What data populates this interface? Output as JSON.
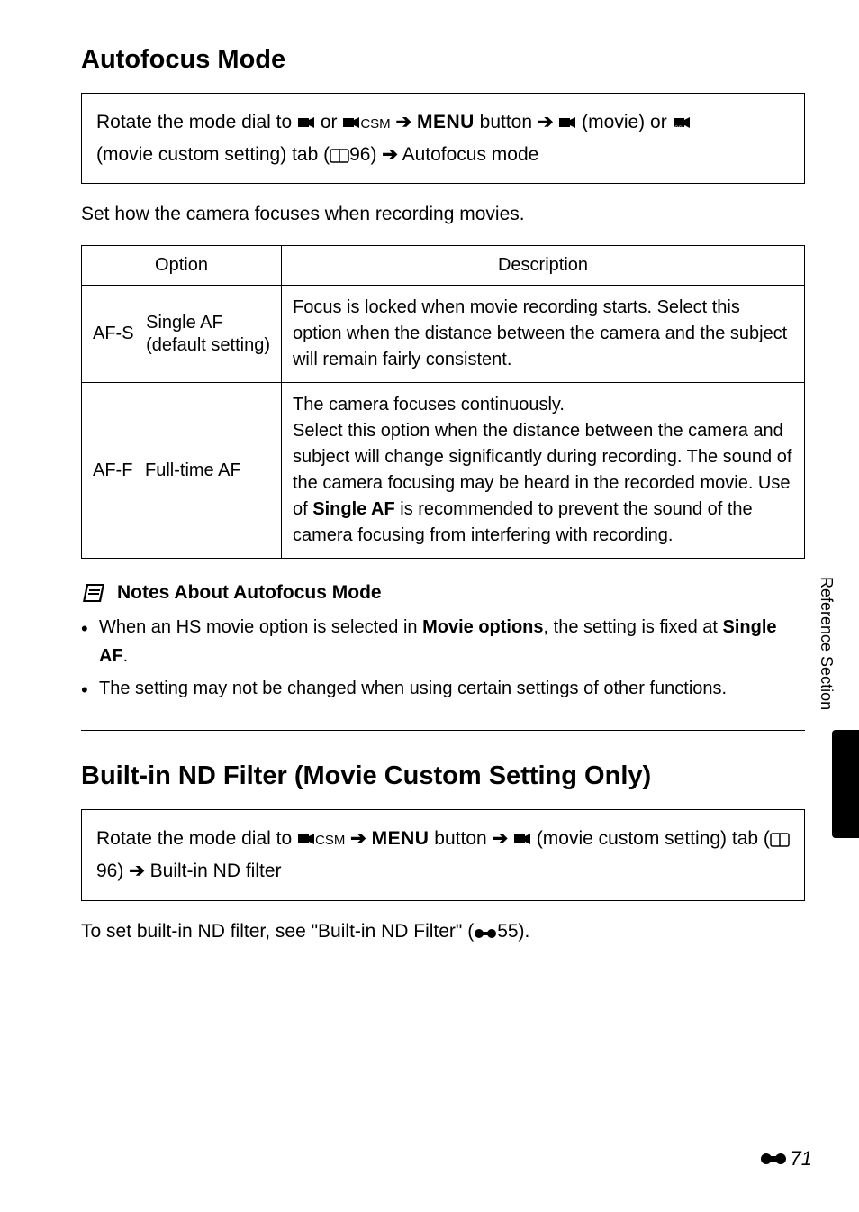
{
  "section1": {
    "title": "Autofocus Mode",
    "nav": {
      "prefix": "Rotate the mode dial to ",
      "or": " or ",
      "csm_after_movie": "CSM",
      "menu_button": " button ",
      "movie_or": " (movie) or ",
      "custom_tab": "(movie custom setting) tab (",
      "page_ref": "96) ",
      "tail": " Autofocus mode",
      "menu_label": "MENU"
    },
    "intro": "Set how the camera focuses when recording movies.",
    "table": {
      "headers": {
        "option": "Option",
        "description": "Description"
      },
      "rows": [
        {
          "code": "AF-S",
          "label_line1": "Single AF",
          "label_line2": "(default setting)",
          "description": "Focus is locked when movie recording starts. Select this option when the distance between the camera and the subject will remain fairly consistent."
        },
        {
          "code": "AF-F",
          "label_line1": "Full-time AF",
          "label_line2": "",
          "description_pre": "The camera focuses continuously.\nSelect this option when the distance between the camera and subject will change significantly during recording. The sound of the camera focusing may be heard in the recorded movie. Use of ",
          "description_bold": "Single AF",
          "description_post": " is recommended to prevent the sound of the camera focusing from interfering with recording."
        }
      ]
    },
    "notes": {
      "heading": "Notes About Autofocus Mode",
      "items": [
        {
          "pre": "When an HS movie option is selected in ",
          "bold1": "Movie options",
          "mid": ", the setting is fixed at ",
          "bold2": "Single AF",
          "post": "."
        },
        {
          "text": "The setting may not be changed when using certain settings of other functions."
        }
      ]
    }
  },
  "section2": {
    "title": "Built-in ND Filter (Movie Custom Setting Only)",
    "nav": {
      "prefix": "Rotate the mode dial to ",
      "csm_after_movie": "CSM",
      "menu_button": " button ",
      "custom_tab_tail": " (movie custom setting) tab (",
      "page_ref": "96) ",
      "tail": " Built-in ND filter",
      "menu_label": "MENU"
    },
    "para_pre": "To set built-in ND filter, see \"Built-in ND Filter\" (",
    "para_ref": "55).",
    "para_icon_label": "reference-icon"
  },
  "side": {
    "label": "Reference Section"
  },
  "page_number": "71"
}
